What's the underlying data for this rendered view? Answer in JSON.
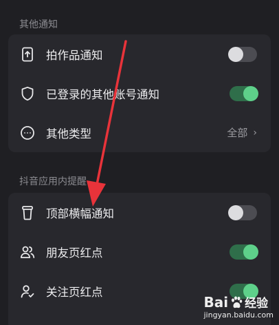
{
  "sections": [
    {
      "header": "其他通知",
      "items": [
        {
          "icon": "upload-phone-icon",
          "label": "拍作品通知",
          "control": "toggle",
          "on": false
        },
        {
          "icon": "shield-icon",
          "label": "已登录的其他账号通知",
          "control": "toggle",
          "on": true
        },
        {
          "icon": "more-circle-icon",
          "label": "其他类型",
          "control": "link",
          "value": "全部",
          "chevron": "›"
        }
      ]
    },
    {
      "header": "抖音应用内提醒",
      "items": [
        {
          "icon": "cup-icon",
          "label": "顶部横幅通知",
          "control": "toggle",
          "on": false
        },
        {
          "icon": "friends-icon",
          "label": "朋友页红点",
          "control": "toggle",
          "on": true
        },
        {
          "icon": "follow-user-icon",
          "label": "关注页红点",
          "control": "toggle",
          "on": true
        }
      ]
    }
  ],
  "annotation": {
    "color": "#e8333a",
    "type": "arrow"
  },
  "watermark": {
    "brand_prefix": "Bai",
    "brand_suffix": "经验",
    "url": "jingyan.baidu.com"
  },
  "colors": {
    "background": "#1f1f23",
    "card": "#28282d",
    "toggle_on": "#5ed08a",
    "toggle_off": "#dcdcdf"
  }
}
